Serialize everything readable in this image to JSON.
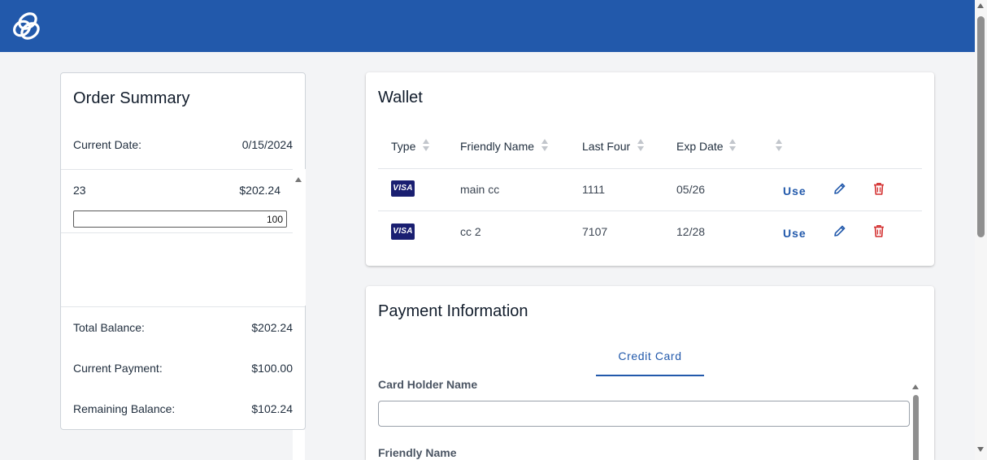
{
  "header": {
    "logo_icon": "interlocked-rings-logo",
    "brand_color": "#2259ab"
  },
  "order_summary": {
    "title": "Order Summary",
    "current_date_label": "Current Date:",
    "current_date_value": "0/15/2024",
    "items": [
      {
        "id": "23",
        "amount": "$202.24",
        "payment_input": "100"
      }
    ],
    "total_balance_label": "Total Balance:",
    "total_balance_value": "$202.24",
    "current_payment_label": "Current Payment:",
    "current_payment_value": "$100.00",
    "remaining_balance_label": "Remaining Balance:",
    "remaining_balance_value": "$102.24"
  },
  "wallet": {
    "title": "Wallet",
    "columns": [
      "Type",
      "Friendly Name",
      "Last Four",
      "Exp Date",
      ""
    ],
    "rows": [
      {
        "type": "VISA",
        "friendly_name": "main cc",
        "last_four": "1111",
        "exp_date": "05/26",
        "use_label": "Use"
      },
      {
        "type": "VISA",
        "friendly_name": "cc 2",
        "last_four": "7107",
        "exp_date": "12/28",
        "use_label": "Use"
      }
    ],
    "edit_icon": "pencil-icon",
    "delete_icon": "trash-icon"
  },
  "payment": {
    "title": "Payment Information",
    "tabs": [
      "Credit Card"
    ],
    "card_holder_label": "Card Holder Name",
    "card_holder_value": "",
    "friendly_name_label": "Friendly Name"
  }
}
